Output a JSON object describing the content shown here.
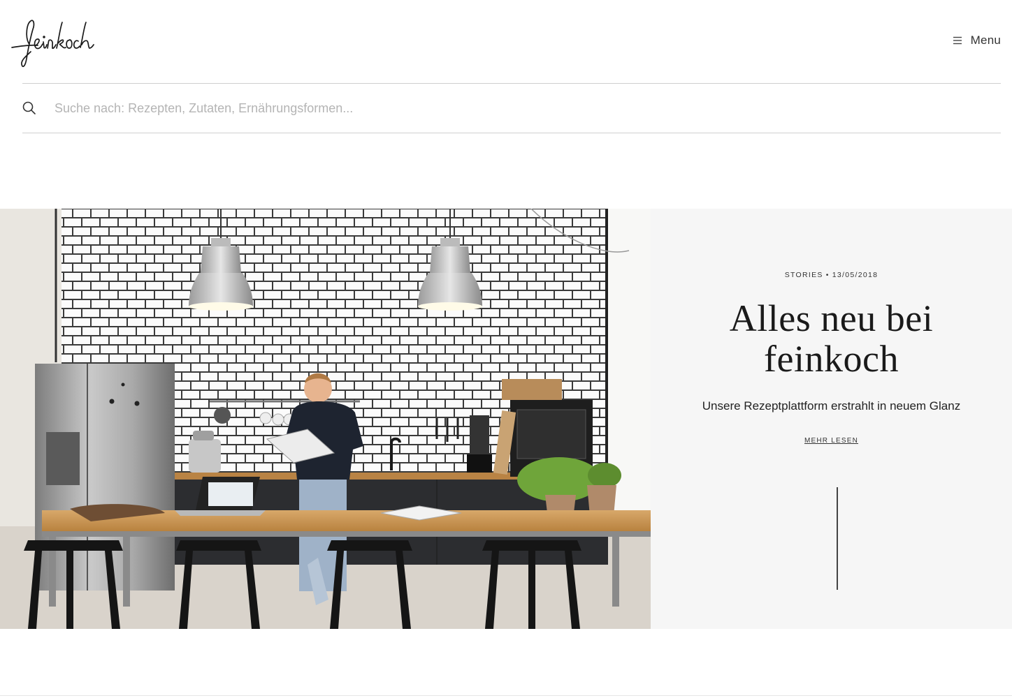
{
  "header": {
    "logo_text": "feinkoch",
    "menu_label": "Menu",
    "menu_icon": "hamburger-icon"
  },
  "search": {
    "icon": "search-icon",
    "placeholder": "Suche nach: Rezepten, Zutaten, Ernährungsformen...",
    "value": ""
  },
  "hero": {
    "image": "kitchen-photo",
    "category": "STORIES",
    "separator": "•",
    "date": "13/05/2018",
    "title": "Alles neu bei feinkoch",
    "subtitle": "Unsere Rezeptplattform erstrahlt in neuem Glanz",
    "link_label": "MEHR LESEN"
  },
  "colors": {
    "panel_bg": "#f6f6f6",
    "text": "#1c1c1c",
    "rule": "#cfcfcf"
  }
}
